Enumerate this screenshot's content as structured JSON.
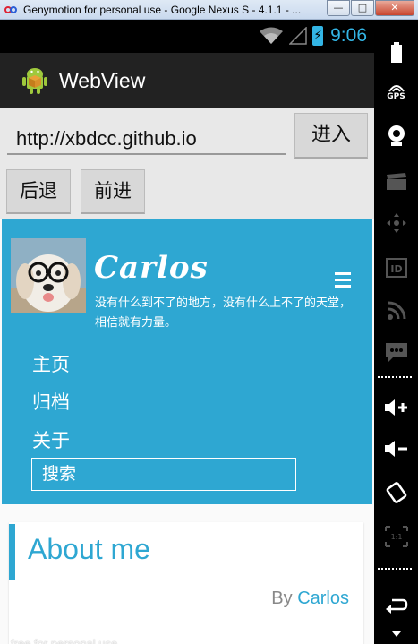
{
  "window": {
    "title": "Genymotion for personal use - Google Nexus S - 4.1.1 - ...",
    "minimize": "—",
    "maximize": "□",
    "close": "✕"
  },
  "status_bar": {
    "time": "9:06",
    "battery_glyph": "⚡"
  },
  "action_bar": {
    "title": "WebView",
    "icon": "android-robot-icon"
  },
  "browser": {
    "url_value": "http://xbdcc.github.io",
    "enter_label": "进入",
    "back_label": "后退",
    "forward_label": "前进"
  },
  "site": {
    "name": "Carlos",
    "tagline": "没有什么到不了的地方，没有什么上不了的天堂，相信就有力量。",
    "nav": [
      "主页",
      "归档",
      "关于"
    ],
    "search_placeholder": "搜索"
  },
  "post": {
    "title": "About me",
    "by_prefix": "By ",
    "author": "Carlos"
  },
  "watermark": "free for personal use",
  "side_panel": {
    "gps_label": "GPS",
    "icons": [
      "battery-icon",
      "gps-icon",
      "webcam-icon",
      "clapper-icon",
      "dpad-icon",
      "id-icon",
      "rss-icon",
      "sms-icon",
      "volume-up-icon",
      "volume-down-icon",
      "rotate-icon",
      "scale-icon",
      "back-icon"
    ]
  },
  "colors": {
    "accent": "#2ea7d2",
    "holo_blue": "#33b5e5",
    "action_bar": "#222222"
  }
}
